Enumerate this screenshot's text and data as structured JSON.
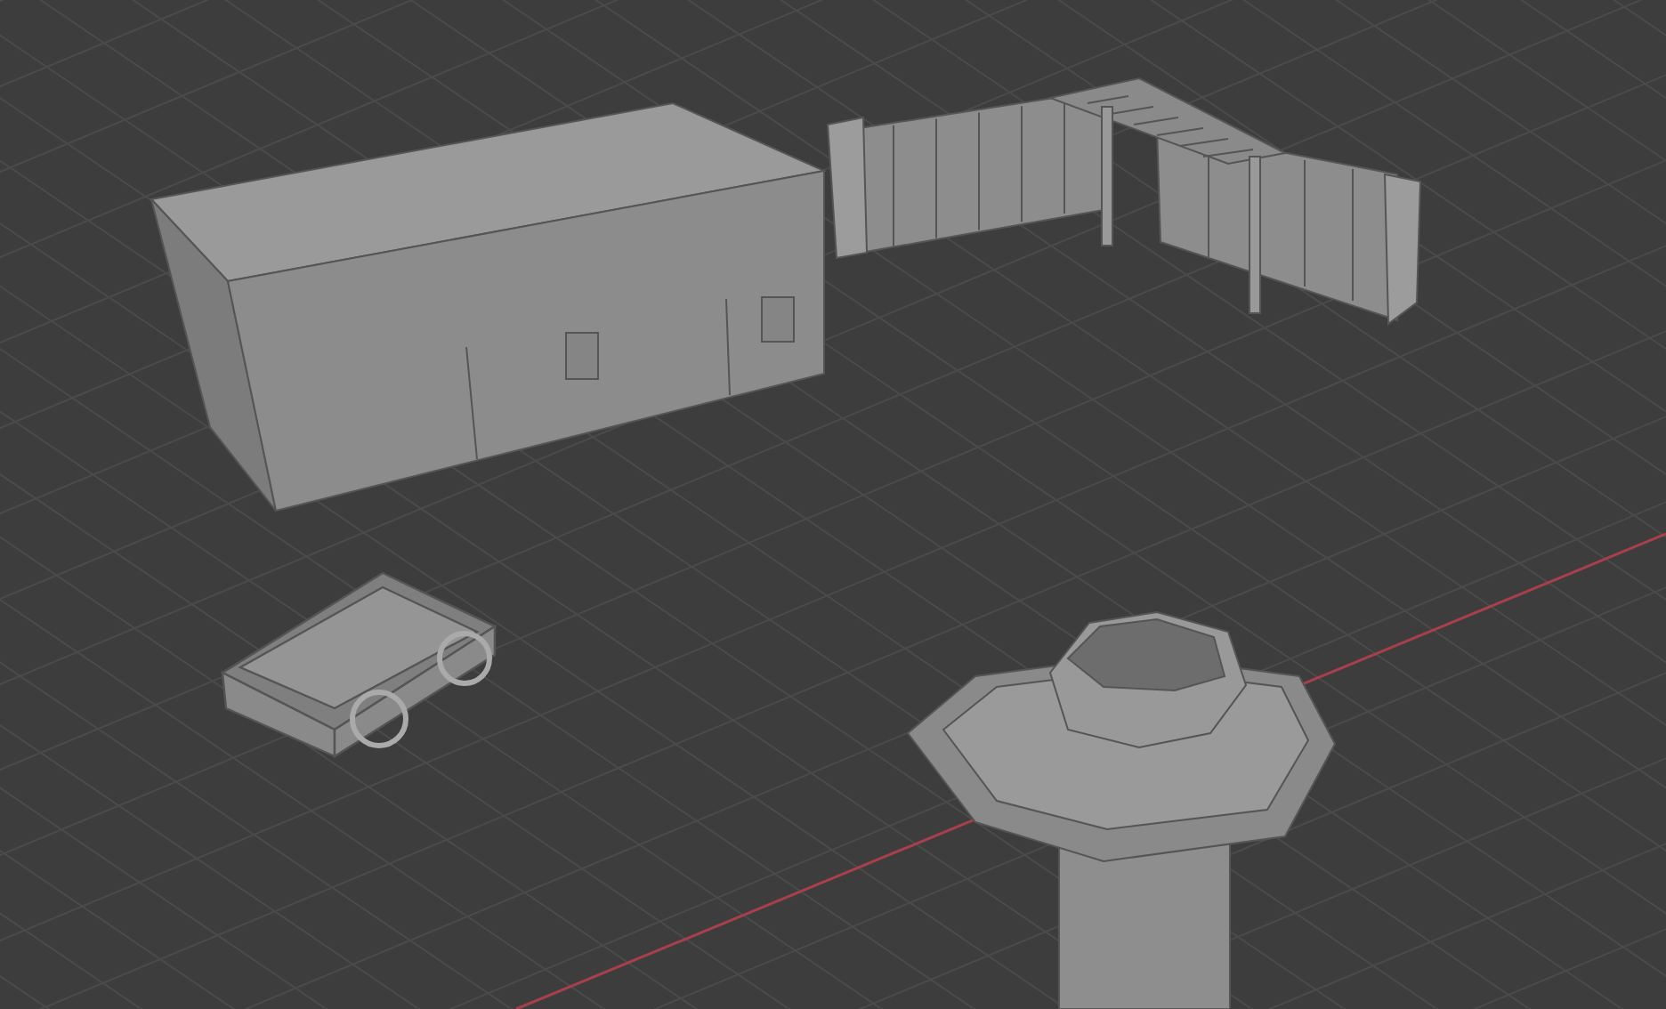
{
  "viewport": {
    "show_x_axis": true,
    "objects": [
      {
        "kind": "building"
      },
      {
        "kind": "fence"
      },
      {
        "kind": "pergola"
      },
      {
        "kind": "cart"
      },
      {
        "kind": "well"
      }
    ]
  }
}
